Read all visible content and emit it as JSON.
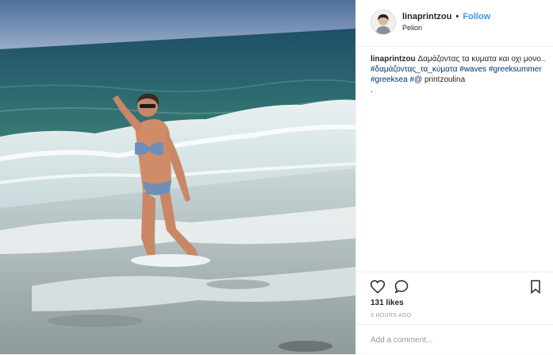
{
  "post": {
    "username": "linaprintzou",
    "dot": "•",
    "follow_label": "Follow",
    "location": "Pelion",
    "caption": {
      "username": "linaprintzou",
      "text": "Δαμάζοντας τα κυματα και οχι μονο..",
      "hashtags": [
        "#δαμάζοντας_τα_κύματα",
        "#waves",
        "#greeksummer",
        "#greeksea"
      ],
      "mention_prefix": "#@",
      "mention": "printzoulina",
      "trailing": "."
    },
    "likes": "131 likes",
    "timestamp": "3 HOURS AGO",
    "comment_placeholder": "Add a comment...",
    "icons": {
      "like": "heart-icon",
      "comment": "comment-bubble-icon",
      "save": "bookmark-icon"
    }
  },
  "colors": {
    "link": "#3897f0",
    "hashtag": "#003569",
    "text": "#262626",
    "muted": "#999999"
  }
}
